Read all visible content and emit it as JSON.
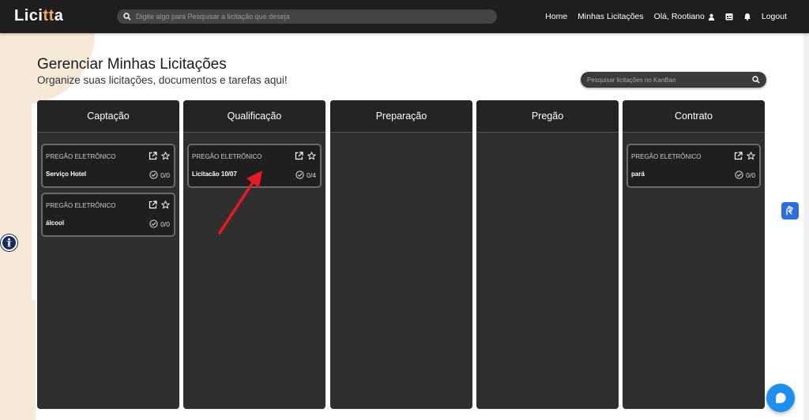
{
  "app": {
    "logo_prefix": "Lici",
    "logo_accent": "tt",
    "logo_suffix": "a"
  },
  "search": {
    "placeholder": "Digite algo para Pesquisar a licitação que deseja"
  },
  "nav": {
    "home": "Home",
    "minhas": "Minhas Licitações",
    "user": "Olá, Rootiano",
    "logout": "Logout"
  },
  "page": {
    "title": "Gerenciar Minhas Licitações",
    "subtitle": "Organize suas licitações, documentos e tarefas aqui!"
  },
  "kanban_search": {
    "placeholder": "Pesquisar licitações no KanBan"
  },
  "columns": [
    {
      "title": "Captação",
      "cards": [
        {
          "type": "PREGÃO ELETRÔNICO",
          "name": "Serviço Hotel",
          "count": "0/0"
        },
        {
          "type": "PREGÃO ELETRÔNICO",
          "name": "álcool",
          "count": "0/0"
        }
      ]
    },
    {
      "title": "Qualificação",
      "cards": [
        {
          "type": "PREGÃO ELETRÔNICO",
          "name": "Licitacão 10/07",
          "count": "0/4"
        }
      ]
    },
    {
      "title": "Preparação",
      "cards": []
    },
    {
      "title": "Pregão",
      "cards": []
    },
    {
      "title": "Contrato",
      "cards": [
        {
          "type": "PREGÃO ELETRÔNICO",
          "name": "pará",
          "count": "0/0"
        }
      ]
    }
  ],
  "colors": {
    "topbar": "#1e1e1e",
    "column": "#2f2f2f",
    "accent": "#f0a860",
    "arrow": "#e8191f",
    "chat": "#1e8ff0"
  }
}
